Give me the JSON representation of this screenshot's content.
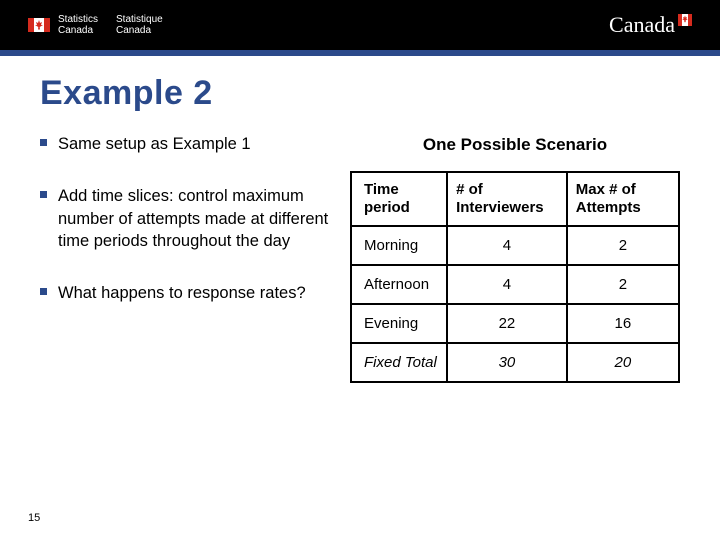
{
  "header": {
    "agency_en_line1": "Statistics",
    "agency_en_line2": "Canada",
    "agency_fr_line1": "Statistique",
    "agency_fr_line2": "Canada",
    "wordmark": "Canada"
  },
  "title": "Example 2",
  "bullets": [
    "Same setup as Example 1",
    "Add time slices: control maximum number of attempts made at different time periods throughout the day",
    "What happens to response rates?"
  ],
  "scenario": {
    "heading": "One Possible Scenario",
    "columns": [
      "Time period",
      "# of Interviewers",
      "Max # of Attempts"
    ],
    "rows": [
      {
        "period": "Morning",
        "interviewers": "4",
        "attempts": "2",
        "italic": false
      },
      {
        "period": "Afternoon",
        "interviewers": "4",
        "attempts": "2",
        "italic": false
      },
      {
        "period": "Evening",
        "interviewers": "22",
        "attempts": "16",
        "italic": false
      },
      {
        "period": "Fixed Total",
        "interviewers": "30",
        "attempts": "20",
        "italic": true
      }
    ]
  },
  "page_number": "15",
  "chart_data": {
    "type": "table",
    "title": "One Possible Scenario",
    "columns": [
      "Time period",
      "# of Interviewers",
      "Max # of Attempts"
    ],
    "rows": [
      [
        "Morning",
        4,
        2
      ],
      [
        "Afternoon",
        4,
        2
      ],
      [
        "Evening",
        22,
        16
      ],
      [
        "Fixed Total",
        30,
        20
      ]
    ]
  }
}
